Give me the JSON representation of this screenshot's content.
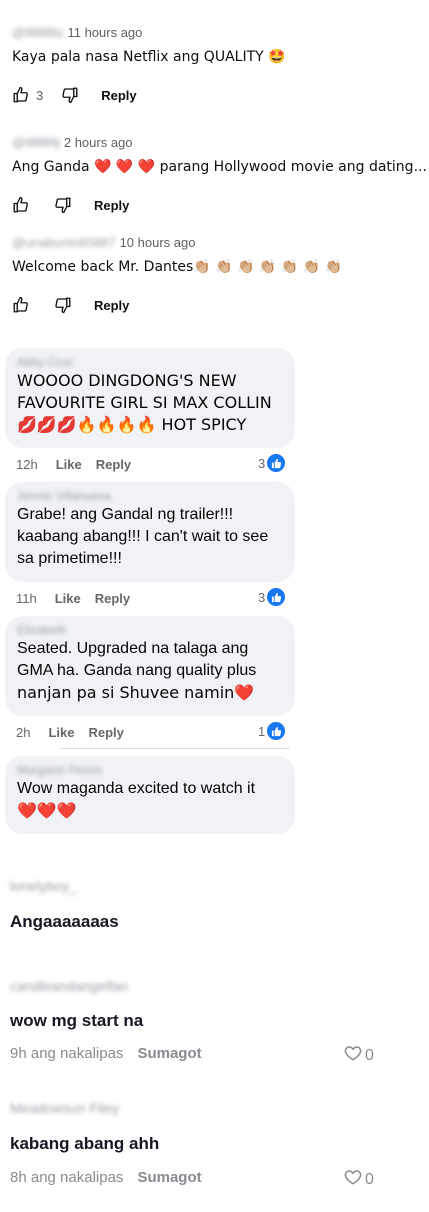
{
  "youtube_comments": [
    {
      "user": "@lllllllllllz",
      "time": "11 hours ago",
      "text": "Kaya pala nasa Netflix ang QUALITY 🤩",
      "likes": "3",
      "reply": "Reply"
    },
    {
      "user": "@lllllllllllj",
      "time": "2 hours ago",
      "text": "Ang Ganda ❤️ ❤️ ❤️ parang Hollywood movie ang dating...",
      "likes": "",
      "reply": "Reply"
    },
    {
      "user": "@unabunto65887",
      "time": "10 hours ago",
      "text": "Welcome back Mr. Dantes👏🏼 👏🏼 👏🏼 👏🏼 👏🏼 👏🏼 👏🏼",
      "likes": "",
      "reply": "Reply"
    }
  ],
  "facebook_comments": [
    {
      "user": "Abby Cruz",
      "lines": [
        "WOOOO DINGDONG'S NEW",
        "FAVOURITE GIRL SI MAX COLLIN",
        "💋💋💋🔥🔥🔥🔥 HOT SPICY"
      ],
      "time": "12h",
      "like": "Like",
      "reply": "Reply",
      "reactions": "3"
    },
    {
      "user": "Jennie Villanueva",
      "lines": [
        "Grabe! ang Gandal ng trailer!!!",
        "kaabang abang!!! I can't wait to see",
        "sa primetime!!!"
      ],
      "time": "11h",
      "like": "Like",
      "reply": "Reply",
      "reactions": "3"
    },
    {
      "user": "Elizabeth",
      "lines": [
        "Seated. Upgraded na talaga ang",
        "GMA ha. Ganda nang quality plus",
        "nanjan pa si Shuvee namin❤️"
      ],
      "time": "2h",
      "like": "Like",
      "reply": "Reply",
      "reactions": "1"
    },
    {
      "user": "Margaret Flores",
      "lines": [
        "Wow maganda excited to watch it",
        "❤️❤️❤️"
      ]
    }
  ],
  "tiktok_comments": [
    {
      "user": "lonelyboy_",
      "text": "Angaaaaaaas"
    },
    {
      "user": "candleandangelfan",
      "text": "wow mg start na",
      "time": "9h ang nakalipas",
      "reply": "Sumagot",
      "likes": "0"
    },
    {
      "user": "Meadowsun Filey",
      "text": "kabang abang ahh",
      "time": "8h ang nakalipas",
      "reply": "Sumagot",
      "likes": "0"
    }
  ],
  "colors": {
    "fb_blue": "#1877f2",
    "bubble": "#f0f2f5",
    "heart": "#e0245e"
  },
  "icons": [
    "thumbs-up-icon",
    "thumbs-down-icon",
    "facebook-like-icon",
    "heart-outline-icon"
  ]
}
